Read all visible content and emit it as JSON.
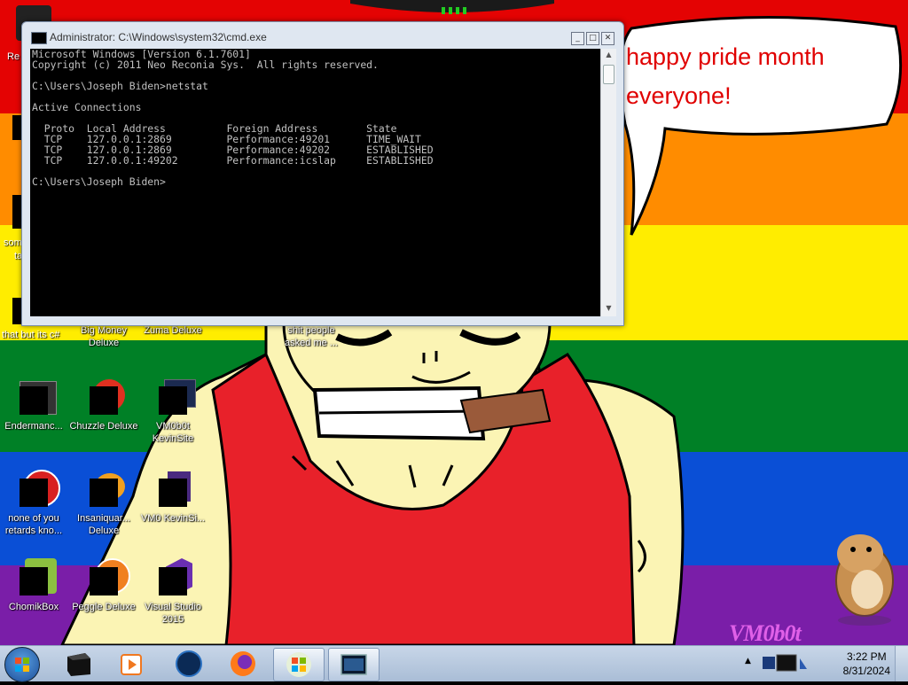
{
  "window": {
    "title": "Administrator: C:\\Windows\\system32\\cmd.exe",
    "minimize": "_",
    "maximize": "□",
    "close": "✕"
  },
  "console": {
    "lines": [
      "Microsoft Windows [Version 6.1.7601]",
      "Copyright (c) 2011 Neo Reconia Sys.  All rights reserved.",
      "",
      "C:\\Users\\Joseph Biden>netstat",
      "",
      "Active Connections",
      "",
      "  Proto  Local Address          Foreign Address        State",
      "  TCP    127.0.0.1:2869         Performance:49201      TIME_WAIT",
      "  TCP    127.0.0.1:2869         Performance:49202      ESTABLISHED",
      "  TCP    127.0.0.1:49202        Performance:icslap     ESTABLISHED",
      "",
      "C:\\Users\\Joseph Biden>"
    ]
  },
  "wallpaper": {
    "speech_bubble": {
      "line1": "happy pride month",
      "line2": "everyone!"
    },
    "watermark": "VM0b0t",
    "flag_colors": [
      "#e40303",
      "#ff8c00",
      "#ffed00",
      "#008026",
      "#0a4fd6",
      "#7a1ea8"
    ]
  },
  "desktop": {
    "partial_labels": [
      "Re",
      "som",
      "ta",
      "that but its c#"
    ],
    "icons": [
      {
        "id": "big-money",
        "label": "Big Money Deluxe"
      },
      {
        "id": "zuma",
        "label": "Zuma Deluxe"
      },
      {
        "id": "shit-people",
        "label": "shit people asked me ..."
      },
      {
        "id": "enderman",
        "label": "Endermanc..."
      },
      {
        "id": "chuzzle",
        "label": "Chuzzle Deluxe"
      },
      {
        "id": "vm0b0t-kevinsite",
        "label": "VM0b0t KevinSite"
      },
      {
        "id": "none-of-you",
        "label": "none of you retards kno..."
      },
      {
        "id": "insaniquarium",
        "label": "Insaniquar... Deluxe"
      },
      {
        "id": "vm0-kevinsi",
        "label": "VM0 KevinSi..."
      },
      {
        "id": "chomikbox",
        "label": "ChomikBox"
      },
      {
        "id": "peggle",
        "label": "Peggle Deluxe"
      },
      {
        "id": "visual-studio",
        "label": "Visual Studio 2015"
      }
    ]
  },
  "taskbar": {
    "items": [
      {
        "id": "tb-app1",
        "icon": "black-cube-icon"
      },
      {
        "id": "tb-media",
        "icon": "media-player-icon"
      },
      {
        "id": "tb-globe",
        "icon": "globe-icon"
      },
      {
        "id": "tb-firefox",
        "icon": "firefox-icon"
      },
      {
        "id": "tb-windows",
        "icon": "windows-logo-icon"
      },
      {
        "id": "tb-cmd",
        "icon": "cmd-icon"
      }
    ],
    "clock": {
      "time": "3:22 PM",
      "date": "8/31/2024"
    }
  }
}
